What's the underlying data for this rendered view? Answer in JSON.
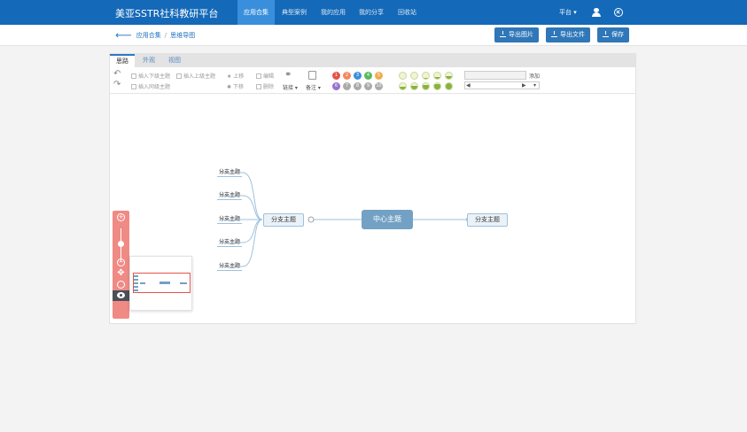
{
  "app": {
    "brand": "美亚SSTR社科教研平台",
    "nav": [
      "应用合集",
      "典型案例",
      "我的应用",
      "我的分享",
      "回收站"
    ],
    "active_nav": "应用合集",
    "platform_menu": "平台 ▾"
  },
  "breadcrumb": {
    "back": "🡐",
    "parent": "应用合集",
    "separator": "/",
    "current": "思维导图"
  },
  "actions": {
    "export_image": "导出图片",
    "export_file": "导出文件",
    "save": "保存"
  },
  "editor": {
    "tabs": [
      "思路",
      "外观",
      "视图"
    ],
    "active_tab": "思路",
    "toolbar": {
      "insert_child": "插入下级主题",
      "insert_parent": "插入上级主题",
      "insert_sibling": "插入同级主题",
      "move_up": "上移",
      "move_down": "下移",
      "edit": "编辑",
      "delete": "删除",
      "link": "链接 ▾",
      "note": "备注 ▾",
      "add": "添加",
      "priority_colors": [
        "#e5534b",
        "#f08a5d",
        "#3a8fdc",
        "#5cb85c",
        "#f0ad4e",
        "#9b6fd0",
        "#aaaaaa",
        "#aaaaaa",
        "#aaaaaa",
        "#aaaaaa"
      ],
      "priority_labels": [
        "1",
        "2",
        "3",
        "4",
        "5",
        "6",
        "7",
        "8",
        "9",
        "10"
      ],
      "progress_levels": [
        0,
        0,
        0.125,
        0.25,
        0.375,
        0.5,
        0.625,
        0.75,
        0.875,
        1
      ]
    },
    "mindmap": {
      "center": "中心主题",
      "left_branch": "分支主题",
      "right_branch": "分支主题",
      "leaves": [
        "分支主题",
        "分支主题",
        "分支主题",
        "分支主题",
        "分支主题"
      ]
    }
  },
  "icons": [
    "undo-icon",
    "redo-icon",
    "user-icon",
    "logout-icon",
    "zoom-in-icon",
    "zoom-out-icon",
    "move-icon",
    "locate-icon",
    "eye-icon"
  ]
}
